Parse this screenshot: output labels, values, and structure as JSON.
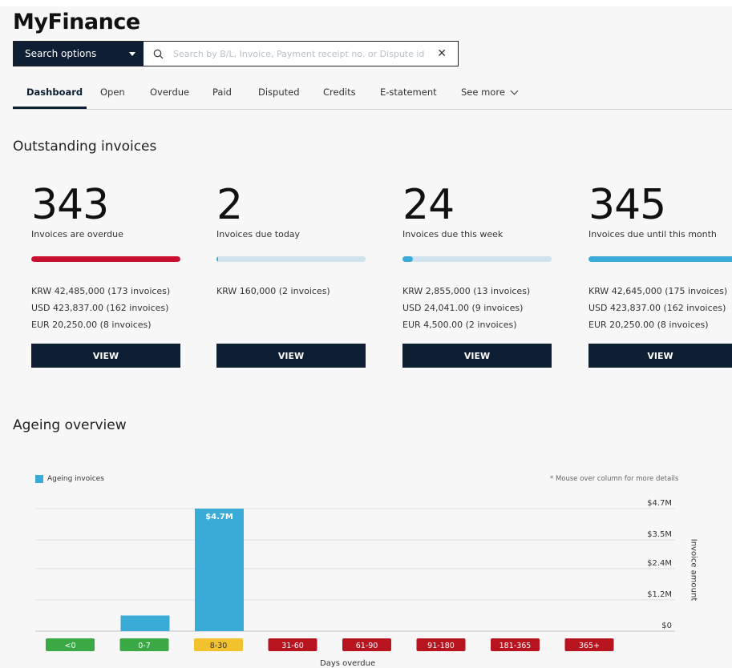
{
  "app": {
    "title": "MyFinance"
  },
  "search": {
    "options_label": "Search options",
    "placeholder": "Search by B/L, Invoice, Payment receipt no. or Dispute id"
  },
  "tabs": [
    {
      "label": "Dashboard"
    },
    {
      "label": "Open"
    },
    {
      "label": "Overdue"
    },
    {
      "label": "Paid"
    },
    {
      "label": "Disputed"
    },
    {
      "label": "Credits"
    },
    {
      "label": "E-statement"
    },
    {
      "label": "See more"
    }
  ],
  "outstanding": {
    "title": "Outstanding invoices",
    "cards": [
      {
        "count": "343",
        "caption": "Invoices are overdue",
        "progress": 1.0,
        "bar_color": "#c8102e",
        "lines": [
          "KRW 42,485,000 (173 invoices)",
          "USD 423,837.00 (162 invoices)",
          "EUR 20,250.00 (8 invoices)"
        ],
        "button": "VIEW"
      },
      {
        "count": "2",
        "caption": "Invoices due today",
        "progress": 0.01,
        "bar_color": "#3aabd6",
        "lines": [
          "KRW 160,000 (2 invoices)"
        ],
        "button": "VIEW"
      },
      {
        "count": "24",
        "caption": "Invoices due this week",
        "progress": 0.07,
        "bar_color": "#3aabd6",
        "lines": [
          "KRW 2,855,000 (13 invoices)",
          "USD 24,041.00 (9 invoices)",
          "EUR 4,500.00 (2 invoices)"
        ],
        "button": "VIEW"
      },
      {
        "count": "345",
        "caption": "Invoices due until this month",
        "progress": 1.0,
        "bar_color": "#3aabd6",
        "lines": [
          "KRW 42,645,000 (175 invoices)",
          "USD 423,837.00 (162 invoices)",
          "EUR 20,250.00 (8 invoices)"
        ],
        "button": "VIEW"
      }
    ]
  },
  "ageing": {
    "title": "Ageing overview",
    "legend": "Ageing invoices",
    "hint": "* Mouse over column for more details"
  },
  "chart_data": {
    "type": "bar",
    "categories": [
      "<0",
      "0-7",
      "8-30",
      "31-60",
      "61-90",
      "91-180",
      "181-365",
      "365+"
    ],
    "category_colors": [
      "#3aa845",
      "#3aa845",
      "#f2c12e",
      "#b8141f",
      "#b8141f",
      "#b8141f",
      "#b8141f",
      "#b8141f"
    ],
    "series": [
      {
        "name": "Ageing invoices",
        "color": "#3aabd6",
        "values": [
          0,
          0.6,
          4.7,
          0,
          0,
          0,
          0,
          0
        ]
      }
    ],
    "data_labels": [
      "",
      "",
      "$4.7M",
      "",
      "",
      "",
      "",
      ""
    ],
    "yticks": [
      0,
      1.2,
      2.4,
      3.5,
      4.7
    ],
    "ytick_labels": [
      "$0",
      "$1.2M",
      "$2.4M",
      "$3.5M",
      "$4.7M"
    ],
    "ylim": [
      0,
      4.7
    ],
    "ylabel": "Invoice amount",
    "xlabel": "Days overdue",
    "grid": true,
    "legend_position": "top-left"
  }
}
